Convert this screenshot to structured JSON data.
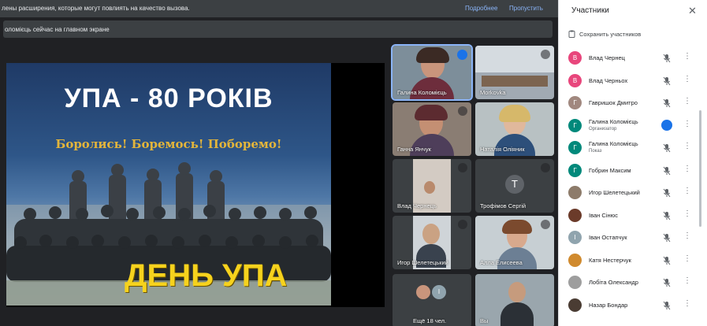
{
  "banner": {
    "text": "лены расширения, которые могут повлиять на качество вызова.",
    "more_link": "Подробнее",
    "skip_link": "Пропустить"
  },
  "presentation": {
    "status": "оломієць сейчас на главном экране"
  },
  "poster": {
    "title": "УПА - 80 РОКІВ",
    "slogan": "Боролись! Боремось! Поборемо!",
    "footer": "ДЕНЬ УПА"
  },
  "tiles": [
    {
      "name": "Галина Коломієць",
      "state": "speaking"
    },
    {
      "name": "Morkovka",
      "state": "muted"
    },
    {
      "name": "Ганна Янчук",
      "state": "muted"
    },
    {
      "name": "Наталія Оліяник",
      "state": "none"
    },
    {
      "name": "Влад Чернець",
      "state": "muted"
    },
    {
      "name": "Трофімов Сергій",
      "initial": "Т",
      "state": "muted"
    },
    {
      "name": "Игор Шелетецький",
      "state": "muted"
    },
    {
      "name": "Алла Елисеева",
      "state": "muted"
    },
    {
      "name": "Ещё 18 чел.",
      "badge": "I"
    },
    {
      "name": "Вы",
      "state": "none"
    }
  ],
  "panel": {
    "title": "Участники",
    "save_label": "Сохранить участников",
    "participants": [
      {
        "name": "Влад Чернец",
        "initial": "В",
        "color": "#e8467c"
      },
      {
        "name": "Влад Черньох",
        "initial": "В",
        "color": "#e8467c"
      },
      {
        "name": "Гавришок Дмитро",
        "initial": "Г",
        "color": "#a1887f"
      },
      {
        "name": "Галина Коломієць",
        "role": "Организатор",
        "initial": "Г",
        "color": "#00897b",
        "speaking": true
      },
      {
        "name": "Галина Коломієць",
        "role": "Показ",
        "initial": "Г",
        "color": "#00897b"
      },
      {
        "name": "Гобрин Максим",
        "initial": "Г",
        "color": "#00897b"
      },
      {
        "name": "Игор Шелетецький",
        "initial": "",
        "color": "#8d7b6a"
      },
      {
        "name": "Іван Сінюс",
        "initial": "",
        "color": "#6b3b2a"
      },
      {
        "name": "Іван Остапчук",
        "initial": "І",
        "color": "#90a4ae"
      },
      {
        "name": "Катя Нестерчук",
        "initial": "",
        "color": "#d08a2e"
      },
      {
        "name": "Лобіта Олександр",
        "initial": "",
        "color": "#9e9e9e"
      },
      {
        "name": "Назар Бондар",
        "initial": "",
        "color": "#4a3c33"
      }
    ]
  },
  "colors": {
    "accent": "#1a73e8",
    "meet_background": "#202124",
    "poster_footer": "#f6d21d"
  }
}
